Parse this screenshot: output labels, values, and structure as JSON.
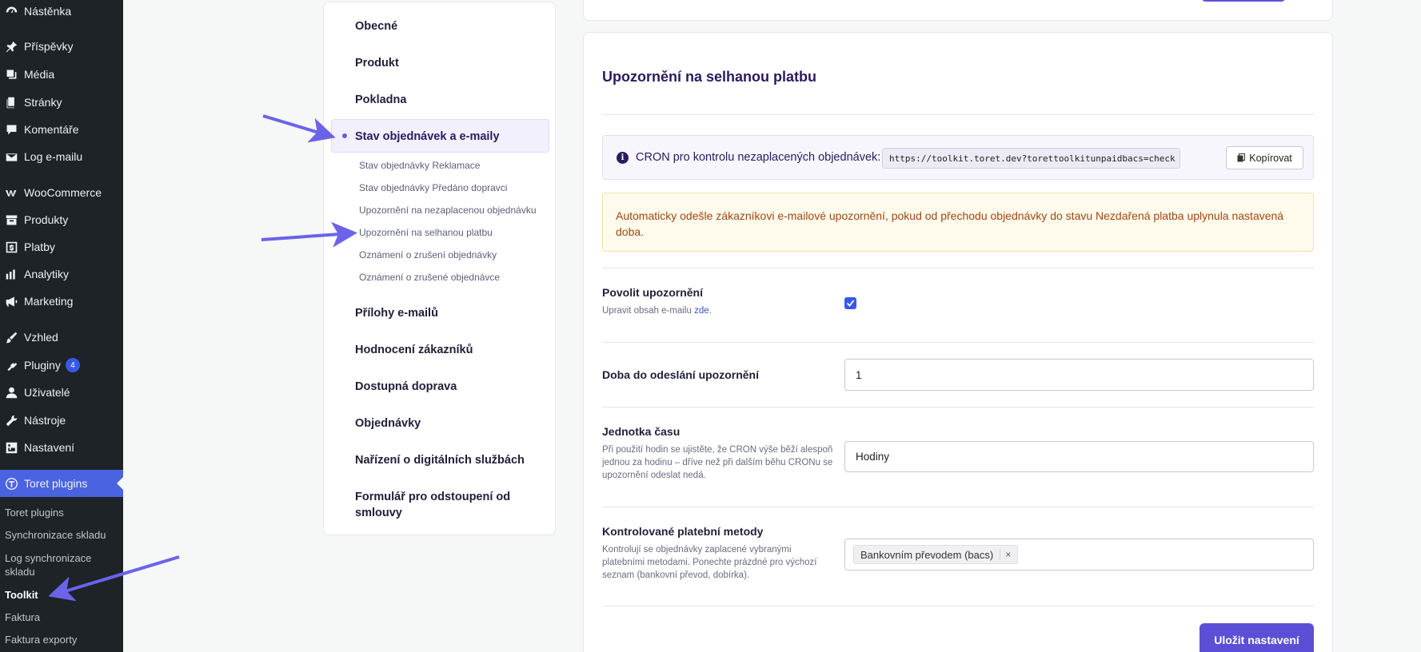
{
  "sidebar": {
    "items": [
      {
        "label": "Nástěnka",
        "icon": "dashboard-icon"
      },
      {
        "label": "Příspěvky",
        "icon": "pin-icon"
      },
      {
        "label": "Média",
        "icon": "media-icon"
      },
      {
        "label": "Stránky",
        "icon": "pages-icon"
      },
      {
        "label": "Komentáře",
        "icon": "comment-icon"
      },
      {
        "label": "Log e-mailu",
        "icon": "mail-icon"
      },
      {
        "label": "WooCommerce",
        "icon": "woo-icon"
      },
      {
        "label": "Produkty",
        "icon": "archive-icon"
      },
      {
        "label": "Platby",
        "icon": "dollar-icon"
      },
      {
        "label": "Analytiky",
        "icon": "bar-chart-icon"
      },
      {
        "label": "Marketing",
        "icon": "megaphone-icon"
      },
      {
        "label": "Vzhled",
        "icon": "brush-icon"
      },
      {
        "label": "Pluginy",
        "icon": "plugin-icon",
        "badge": "4"
      },
      {
        "label": "Uživatelé",
        "icon": "user-icon"
      },
      {
        "label": "Nástroje",
        "icon": "wrench-icon"
      },
      {
        "label": "Nastavení",
        "icon": "settings-icon"
      },
      {
        "label": "Toret plugins",
        "icon": "toret-icon"
      }
    ],
    "submenu": [
      "Toret plugins",
      "Synchronizace skladu",
      "Log synchronizace skladu",
      "Toolkit",
      "Faktura",
      "Faktura exporty"
    ],
    "submenu_current": "Toolkit"
  },
  "settings_nav": {
    "main_top": [
      "Obecné",
      "Produkt",
      "Pokladna"
    ],
    "active": "Stav objednávek a e-maily",
    "sub": [
      "Stav objednávky Reklamace",
      "Stav objednávky Předáno dopravci",
      "Upozornění na nezaplacenou objednávku",
      "Upozornění na selhanou platbu",
      "Oznámení o zrušení objednávky",
      "Oznámení o zrušené objednávce"
    ],
    "main_bottom": [
      "Přílohy e-mailů",
      "Hodnocení zákazníků",
      "Dostupná doprava",
      "Objednávky",
      "Nařízení o digitálních službách",
      "Formulář pro odstoupení od smlouvy"
    ]
  },
  "section": {
    "title": "Upozornění na selhanou platbu",
    "cron_label": "CRON pro kontrolu nezaplacených objednávek:",
    "cron_url": "https://toolkit.toret.dev?torettoolkitunpaidbacs=check",
    "copy_label": "Kopírovat",
    "warning": "Automaticky odešle zákazníkovi e-mailové upozornění, pokud od přechodu objednávky do stavu Nezdařená platba uplynula nastavená doba."
  },
  "fields": {
    "enable": {
      "label": "Povolit upozornění",
      "help_prefix": "Upravit obsah e-mailu ",
      "help_link": "zde",
      "help_suffix": ".",
      "checked": true
    },
    "delay": {
      "label": "Doba do odeslání upozornění",
      "value": "1"
    },
    "unit": {
      "label": "Jednotka času",
      "help": "Při použití hodin se ujistěte, že CRON výše běží alespoň jednou za hodinu – dříve než při dalším běhu CRONu se upozornění odeslat nedá.",
      "value": "Hodiny"
    },
    "methods": {
      "label": "Kontrolované platební metody",
      "help": "Kontrolují se objednávky zaplacené vybranými platebními metodami. Ponechte prázdné pro výchozí seznam (bankovní převod, dobírka).",
      "tag": "Bankovním převodem (bacs)",
      "tag_remove": "×"
    }
  },
  "save_label": "Uložit nastavení",
  "colors": {
    "accent": "#5b4fd6",
    "wp_admin_bg": "#1d2327",
    "wp_active": "#4a63e0",
    "arrow": "#6b63e8"
  }
}
